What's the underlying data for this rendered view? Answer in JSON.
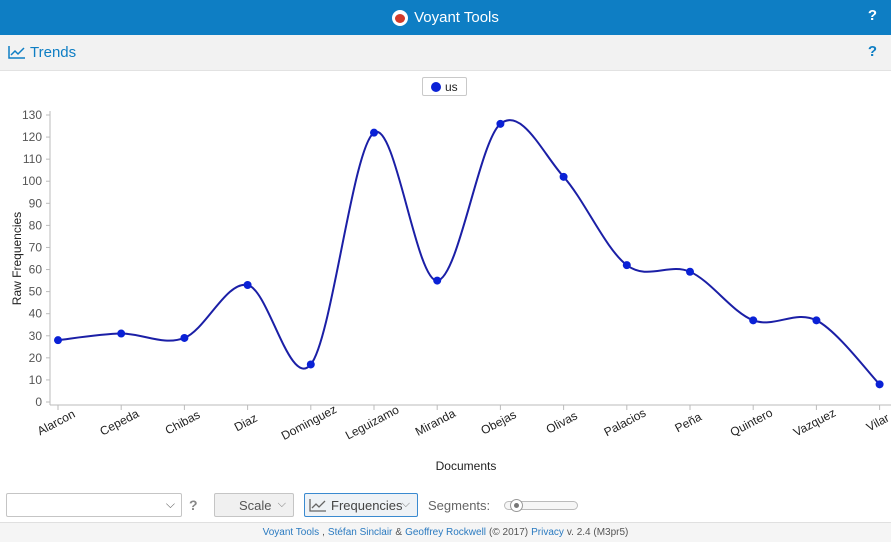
{
  "app": {
    "title": "Voyant Tools",
    "help": "?"
  },
  "panel": {
    "title": "Trends",
    "help": "?"
  },
  "legend": {
    "series_name": "us"
  },
  "toolbar": {
    "search_value": "",
    "help": "?",
    "scale_label": "Scale",
    "frequencies_label": "Frequencies",
    "segments_label": "Segments:",
    "segments_value": 0.08
  },
  "footer": {
    "voyant": "Voyant Tools",
    "sep1": ",",
    "author1": "Stéfan Sinclair",
    "amp": "&",
    "author2": "Geoffrey Rockwell",
    "copyright": "(© 2017)",
    "privacy": "Privacy",
    "version": "v. 2.4 (M3pr5)"
  },
  "colors": {
    "series": "#0a21d6",
    "line": "#1b1fa6",
    "accent": "#0e7ec4"
  },
  "chart_data": {
    "type": "line",
    "xlabel": "Documents",
    "ylabel": "Raw Frequencies",
    "ylim": [
      0,
      130
    ],
    "yticks": [
      0,
      10,
      20,
      30,
      40,
      50,
      60,
      70,
      80,
      90,
      100,
      110,
      120,
      130
    ],
    "categories": [
      "Alarcon",
      "Cepeda",
      "Chibas",
      "Diaz",
      "Dominguez",
      "Leguizamo",
      "Miranda",
      "Obejas",
      "Olivas",
      "Palacios",
      "Peña",
      "Quintero",
      "Vazquez",
      "Vilar"
    ],
    "series": [
      {
        "name": "us",
        "values": [
          28,
          31,
          29,
          53,
          17,
          122,
          55,
          126,
          102,
          62,
          59,
          37,
          37,
          8
        ]
      }
    ],
    "grid": false,
    "legend_position": "top-center"
  }
}
